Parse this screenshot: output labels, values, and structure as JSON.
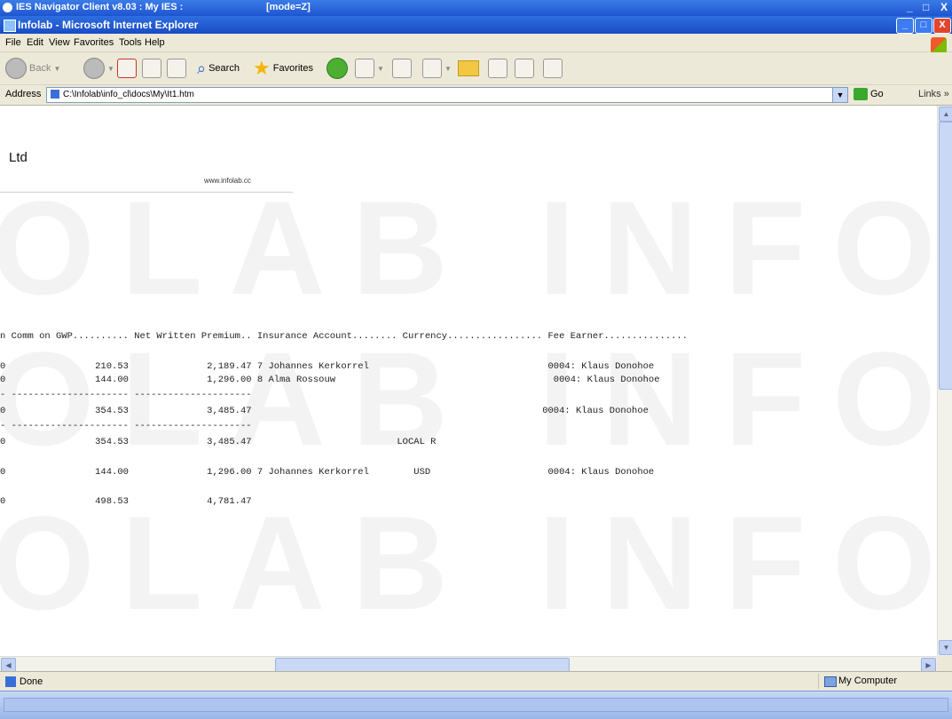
{
  "outer_window": {
    "title": "IES Navigator Client v8.03 : My IES :",
    "subtitle": "[mode=Z]",
    "controls": [
      "_",
      "□",
      "X"
    ]
  },
  "ie_window": {
    "title": "Infolab - Microsoft Internet Explorer",
    "controls": [
      "_",
      "□",
      "X"
    ]
  },
  "menu": [
    "File",
    "Edit",
    "View",
    "Favorites",
    "Tools",
    "Help"
  ],
  "toolbar": {
    "back_label": "Back",
    "search_label": "Search",
    "favorites_label": "Favorites"
  },
  "address_bar": {
    "label": "Address",
    "value": "C:\\Infolab\\info_cl\\docs\\My\\It1.htm",
    "go_label": "Go",
    "links_label": "Links"
  },
  "report": {
    "company_name": "Ltd",
    "company_url": "www.infolab.cc",
    "watermark": "OLAB INFO",
    "header": "n Comm on GWP.......... Net Written Premium.. Insurance Account........ Currency................. Fee Earner...............",
    "lines": [
      "0                210.53              2,189.47 7 Johannes Kerkorrel                                0004: Klaus Donohoe",
      "0                144.00              1,296.00 8 Alma Rossouw                                       0004: Klaus Donohoe",
      "- --------------------- ---------------------",
      "0                354.53              3,485.47                                                    0004: Klaus Donohoe",
      "- --------------------- ---------------------",
      "0                354.53              3,485.47                          LOCAL R",
      "0                144.00              1,296.00 7 Johannes Kerkorrel        USD                     0004: Klaus Donohoe",
      "0                498.53              4,781.47"
    ]
  },
  "status_bar": {
    "text": "Done",
    "zone": "My Computer"
  }
}
